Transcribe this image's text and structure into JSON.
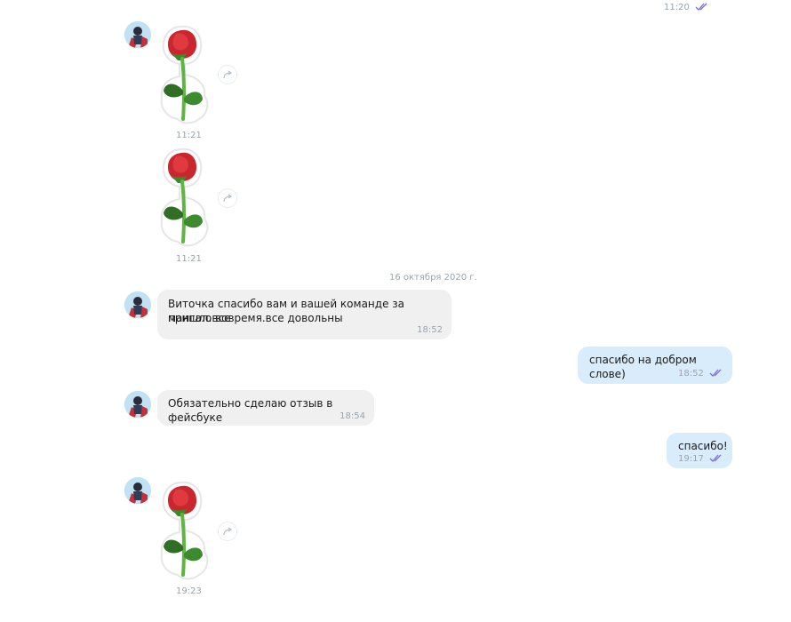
{
  "top": {
    "time": "11:20"
  },
  "date_separator": "16 октября 2020 г.",
  "stickers": [
    {
      "time": "11:21"
    },
    {
      "time": "11:21"
    },
    {
      "time": "19:23"
    }
  ],
  "messages": {
    "in1": {
      "line1": "Виточка спасибо вам и вашей команде за мангал.все",
      "line2": "пришло вовремя.все довольны",
      "time": "18:52"
    },
    "out1": {
      "text": "спасибо на добром слове)",
      "time": "18:52"
    },
    "in2": {
      "text": "Обязательно сделаю отзыв в фейсбуке",
      "time": "18:54"
    },
    "out2": {
      "text": "спасибо!",
      "time": "19:17"
    }
  },
  "colors": {
    "incoming_bubble": "#f0f0f0",
    "outgoing_bubble": "#d9ecfc",
    "read_ticks": "#7b6fd6",
    "timestamp": "#9aa3ae"
  }
}
